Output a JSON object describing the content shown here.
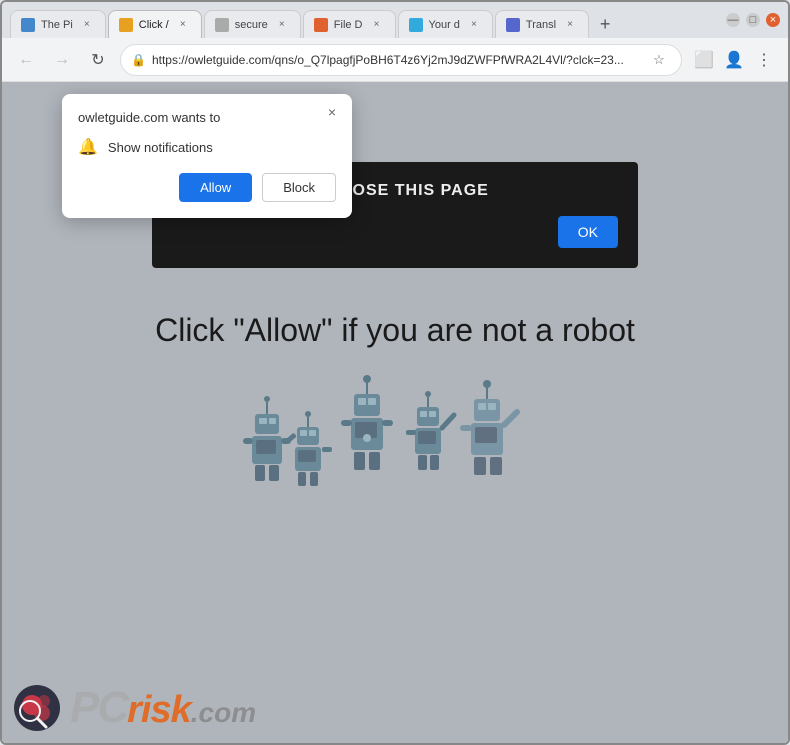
{
  "browser": {
    "tabs": [
      {
        "id": "tab1",
        "title": "The Pi",
        "active": false,
        "favicon_color": "#4488cc"
      },
      {
        "id": "tab2",
        "title": "Click /",
        "active": true,
        "favicon_color": "#e8a020"
      },
      {
        "id": "tab3",
        "title": "secure",
        "active": false,
        "favicon_color": "#aaa"
      },
      {
        "id": "tab4",
        "title": "File D",
        "active": false,
        "favicon_color": "#e06030"
      },
      {
        "id": "tab5",
        "title": "Your d",
        "active": false,
        "favicon_color": "#33aadd"
      },
      {
        "id": "tab6",
        "title": "Transl",
        "active": false,
        "favicon_color": "#5566cc"
      }
    ],
    "url": "https://owletguide.com/qns/o_Q7lpagfjPoBH6T4z6Yj2mJ9dZWFPfWRA2L4Vl/?clck=23...",
    "window_controls": {
      "minimize": "—",
      "maximize": "□",
      "close": "×"
    }
  },
  "notification_popup": {
    "title": "owletguide.com wants to",
    "notification_label": "Show notifications",
    "allow_label": "Allow",
    "block_label": "Block",
    "close_symbol": "×"
  },
  "dark_overlay": {
    "text": "CLICK ALLOW TO CLOSE THIS PAGE",
    "ok_label": "OK"
  },
  "page": {
    "main_text": "Click \"Allow\"   if you are not   a robot"
  },
  "pcrisk": {
    "pc_text": "PC",
    "risk_text": "risk",
    "dotcom_text": ".com"
  }
}
